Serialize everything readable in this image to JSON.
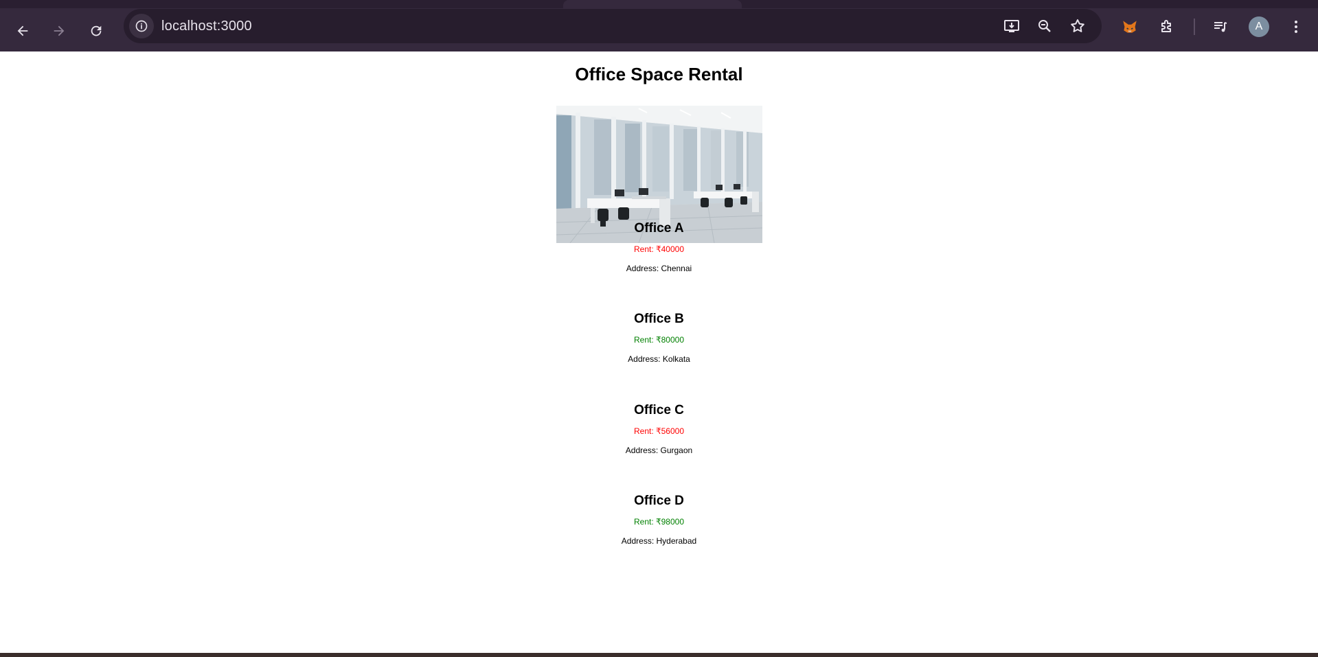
{
  "browser": {
    "url": "localhost:3000",
    "profile_initial": "A",
    "icons": {
      "back": "back-arrow-icon",
      "forward": "forward-arrow-icon",
      "reload": "reload-icon",
      "site_info": "info-icon",
      "install": "install-app-icon",
      "zoom": "zoom-icon",
      "bookmark": "star-icon",
      "metamask": "fox-extension-icon",
      "extensions": "puzzle-icon",
      "media": "media-queue-icon",
      "menu": "kebab-menu-icon"
    }
  },
  "page": {
    "title": "Office Space Rental",
    "offices": [
      {
        "name": "Office A",
        "rent": "Rent: ₹40000",
        "rent_color": "#ff0000",
        "address": "Address: Chennai"
      },
      {
        "name": "Office B",
        "rent": "Rent: ₹80000",
        "rent_color": "#008000",
        "address": "Address: Kolkata"
      },
      {
        "name": "Office C",
        "rent": "Rent: ₹56000",
        "rent_color": "#ff0000",
        "address": "Address: Gurgaon"
      },
      {
        "name": "Office D",
        "rent": "Rent: ₹98000",
        "rent_color": "#008000",
        "address": "Address: Hyderabad"
      }
    ]
  },
  "colors": {
    "chrome_bg": "#35293d",
    "omnibox_bg": "#271d2d",
    "rent_high": "#008000",
    "rent_low": "#ff0000"
  }
}
